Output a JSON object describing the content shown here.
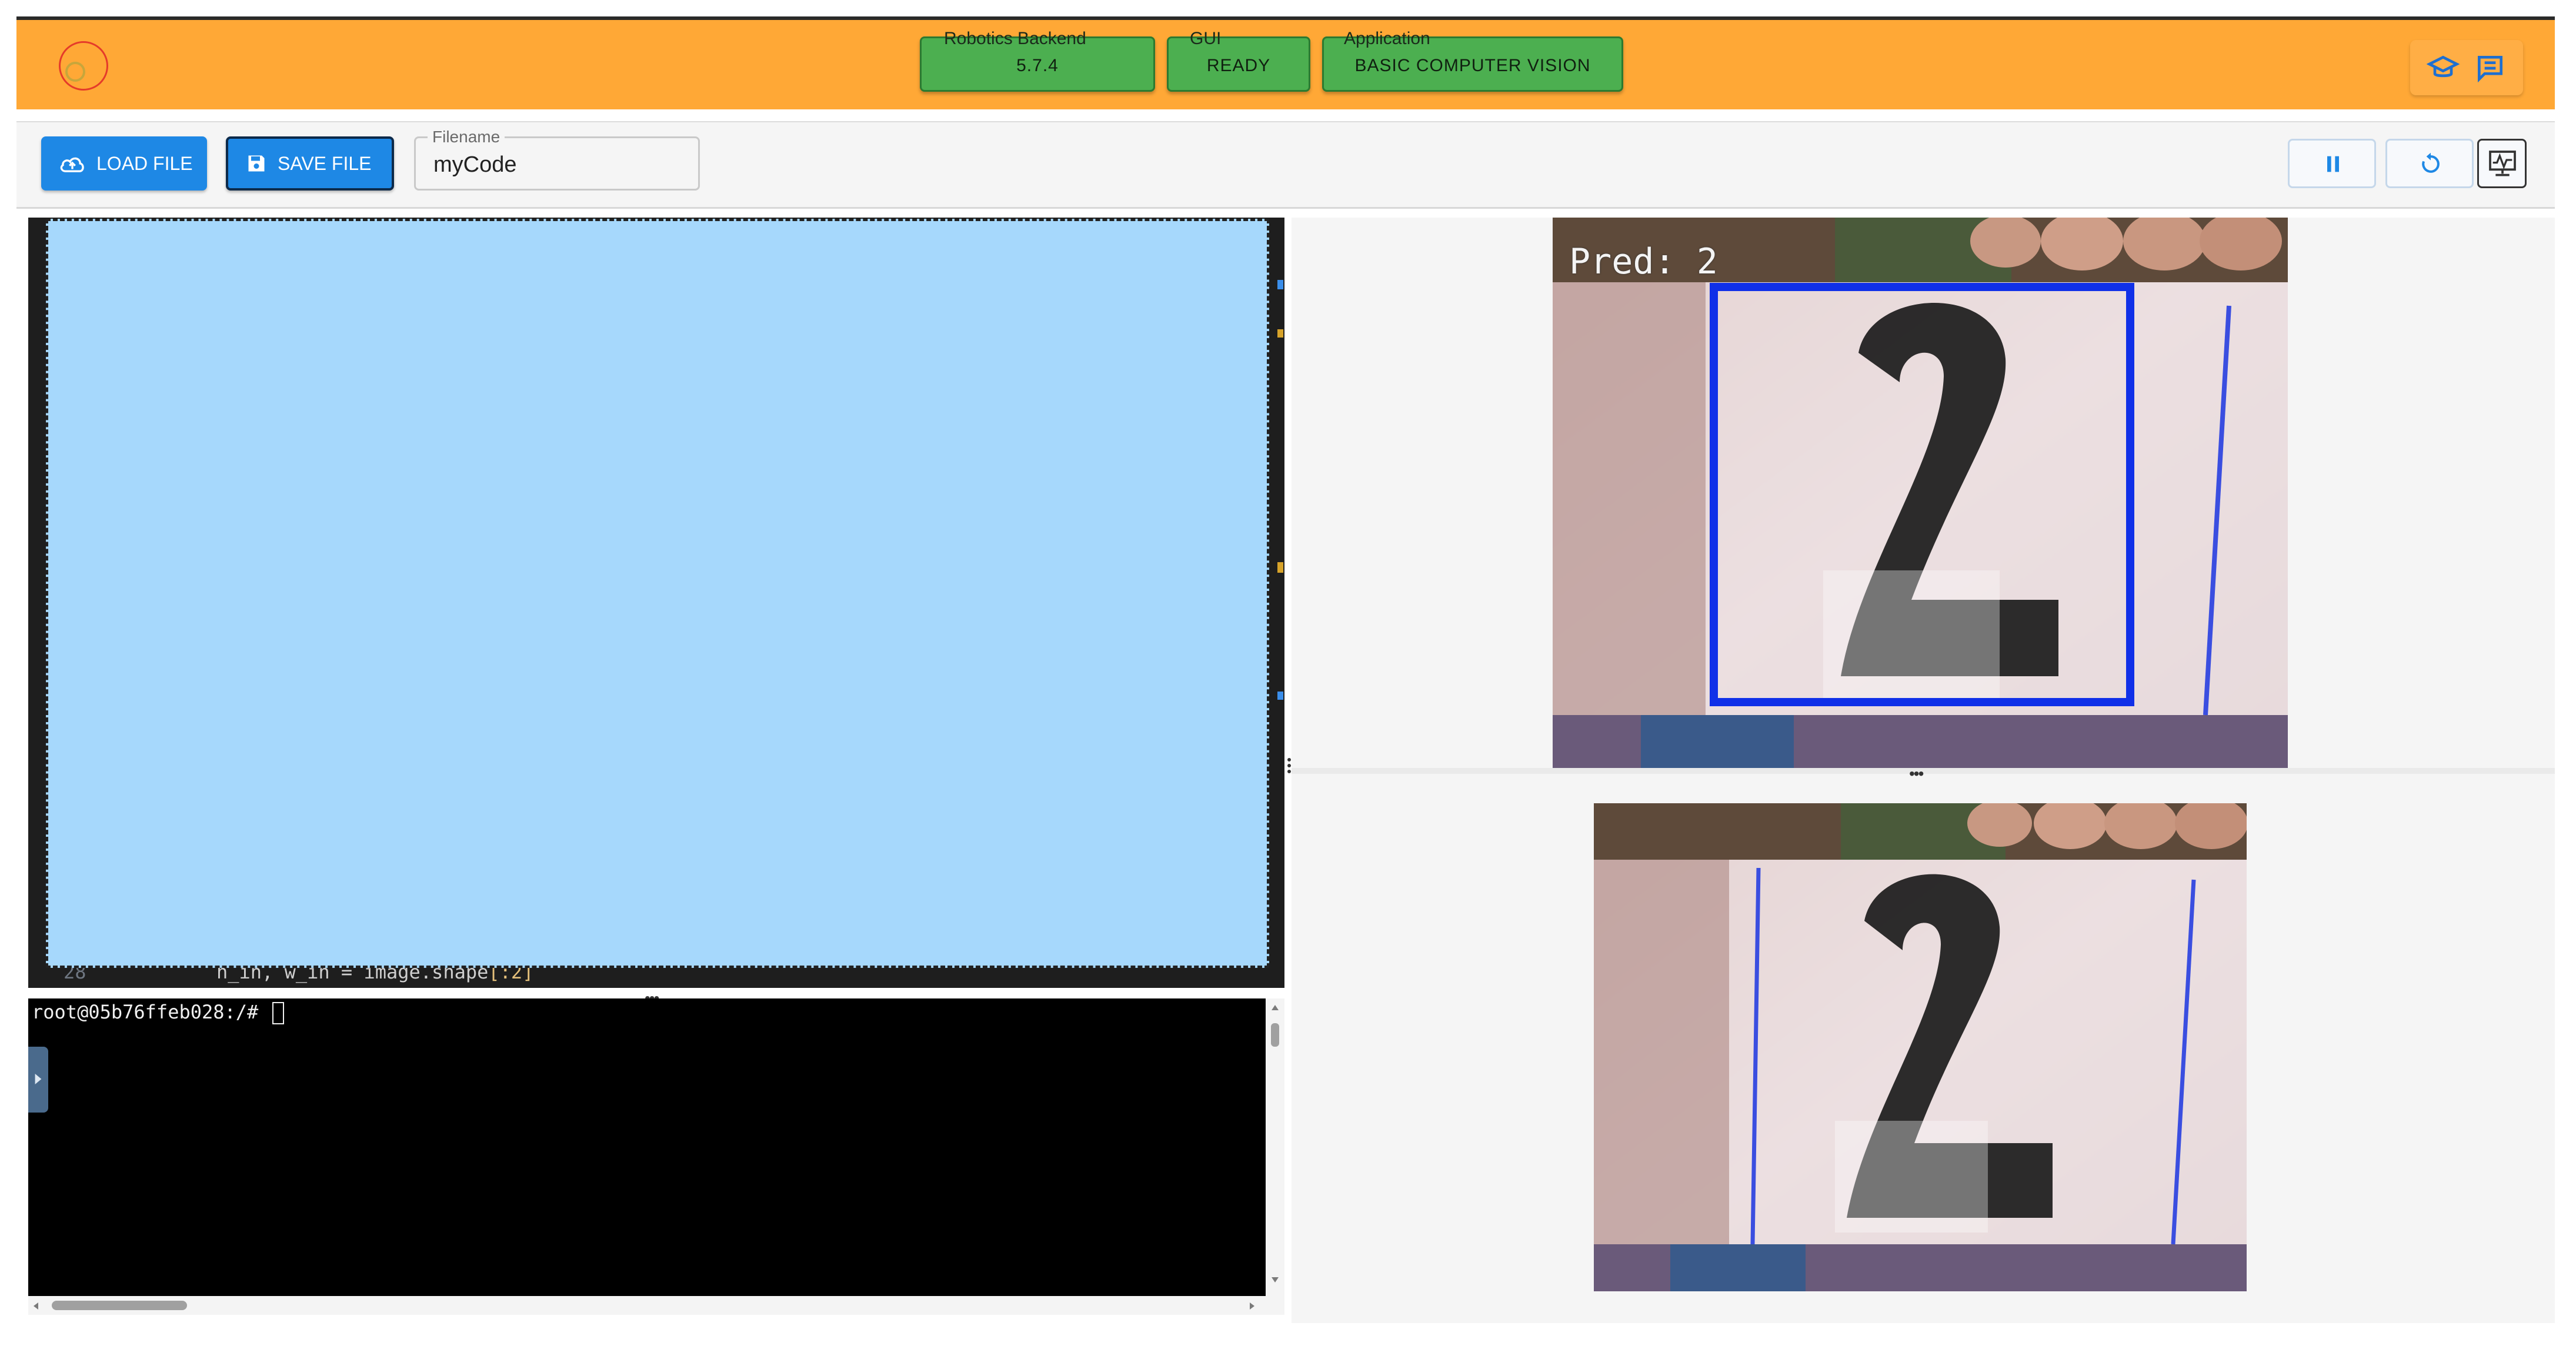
{
  "header": {
    "status": [
      {
        "label": "Robotics Backend",
        "value": "5.7.4"
      },
      {
        "label": "GUI",
        "value": "READY"
      },
      {
        "label": "Application",
        "value": "BASIC COMPUTER VISION"
      }
    ],
    "icons": [
      "graduation-cap-icon",
      "chat-icon"
    ],
    "accent": "#ffa836",
    "status_color": "#4caf50"
  },
  "toolbar": {
    "load_label": "LOAD FILE",
    "save_label": "SAVE FILE",
    "filename_label": "Filename",
    "filename_value": "myCode",
    "controls": [
      "pause-icon",
      "reset-icon",
      "monitor-icon"
    ],
    "button_color": "#1e88e5"
  },
  "editor": {
    "line_number": "28",
    "line_code": "h_in, w_in = image.shape",
    "line_code_bracket": "[:2]"
  },
  "terminal": {
    "prompt": "root@05b76ffeb028:/#"
  },
  "viewer": {
    "prediction_label": "Pred: 2"
  }
}
